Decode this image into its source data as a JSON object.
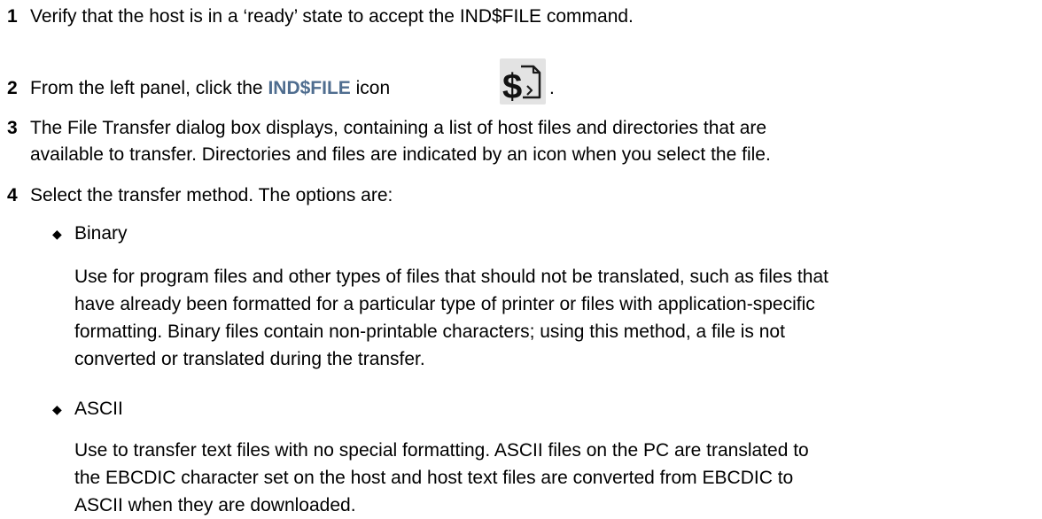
{
  "steps": [
    {
      "num": "1",
      "text": "Verify that the host is in a ‘ready’ state to accept the IND$FILE command."
    },
    {
      "num": "2",
      "before": "From the left panel, click the ",
      "highlight": "IND$FILE",
      "after": " icon",
      "trail": ".",
      "icon": "ind-file-transfer-icon"
    },
    {
      "num": "3",
      "line1": "The File Transfer dialog box displays, containing a list of host files and directories that are",
      "line2": "available to transfer. Directories and files are indicated by an icon when you select the file."
    },
    {
      "num": "4",
      "text": "Select the transfer method. The options are:"
    }
  ],
  "options": [
    {
      "label": "Binary",
      "lines": [
        "Use for program files and other types of files that should not be translated, such as files that",
        "have already been formatted for a particular type of printer or files with application-specific",
        "formatting. Binary files contain non-printable characters; using this method, a file is not",
        "converted or translated during the transfer."
      ]
    },
    {
      "label": "ASCII",
      "lines": [
        "Use to transfer text files with no special formatting. ASCII files on the PC are translated to",
        "the EBCDIC character set on the host and host text files are converted from EBCDIC to",
        "ASCII when they are downloaded."
      ]
    }
  ],
  "bullet_glyph": "◆"
}
